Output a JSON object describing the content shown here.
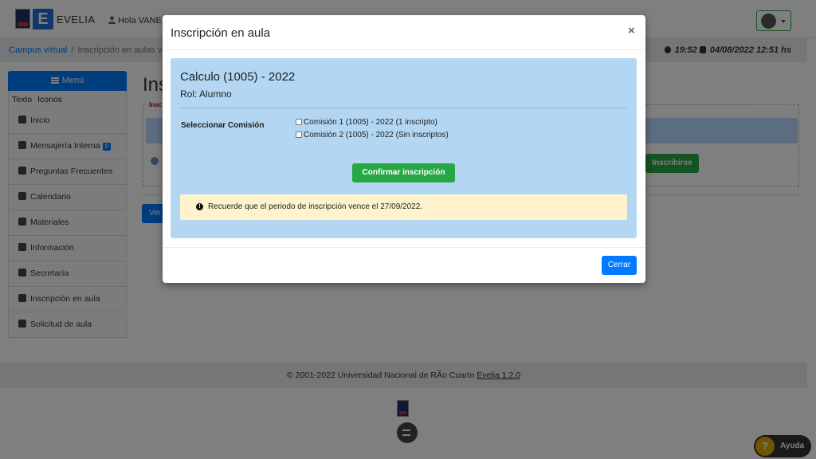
{
  "header": {
    "app_name": "EVELIA",
    "logo_letter": "E",
    "greeting": "Hola VANES",
    "user_icon": "user-icon",
    "avatar_icon": "avatar-icon"
  },
  "breadcrumb": {
    "home": "Campus virtual",
    "separator": "/",
    "current": "Inscripción en aulas virtu"
  },
  "status": {
    "time": "19:52",
    "datetime": "04/08/2022 12:51 hs"
  },
  "sidebar": {
    "menu_label": "Menú",
    "view_modes": [
      "Texto",
      "Iconos"
    ],
    "items": [
      {
        "label": "Inicio",
        "icon": "home-icon"
      },
      {
        "label": "Mensajería Interna",
        "icon": "envelope-icon",
        "badge": "0"
      },
      {
        "label": "Preguntas Frecuentes",
        "icon": "question-circle-icon"
      },
      {
        "label": "Calendario",
        "icon": "calendar-icon"
      },
      {
        "label": "Materiales",
        "icon": "file-icon"
      },
      {
        "label": "Información",
        "icon": "info-circle-icon"
      },
      {
        "label": "Secretaría",
        "icon": "cogs-icon"
      },
      {
        "label": "Inscripción en aula",
        "icon": "sign-in-icon"
      },
      {
        "label": "Solicitud de aula",
        "icon": "desktop-icon"
      }
    ]
  },
  "page": {
    "title_fragment": "Ins",
    "legend_fragment": "Insc",
    "inscribirse_label": "Inscribirse",
    "ver_label": "Ver"
  },
  "footer": {
    "copyright": "© 2001-2022 Universidad Nacional de RÃo Cuarto",
    "version": "Evelia 1.2.0"
  },
  "help": {
    "label": "Ayuda",
    "icon_char": "?"
  },
  "modal": {
    "title": "Inscripción en aula",
    "close_char": "×",
    "course_title": "Calculo (1005) - 2022",
    "role": "Rol: Alumno",
    "commission_label": "Seleccionar Comisión",
    "commissions": [
      {
        "label": "Comisión 1 (1005) - 2022 (1 inscripto)",
        "checked": false
      },
      {
        "label": "Comisión 2 (1005) - 2022 (Sin inscriptos)",
        "checked": false
      }
    ],
    "confirm_label": "Confirmar inscripción",
    "warning_icon": "!",
    "warning_text": "Recuerde que el periodo de inscripción vence el 27/09/2022.",
    "close_button_label": "Cerrar"
  },
  "colors": {
    "primary": "#007bff",
    "success": "#28a745",
    "card_bg": "#b3d7f2",
    "warning_bg": "#fff3cd",
    "help_yellow": "#e0a800"
  }
}
